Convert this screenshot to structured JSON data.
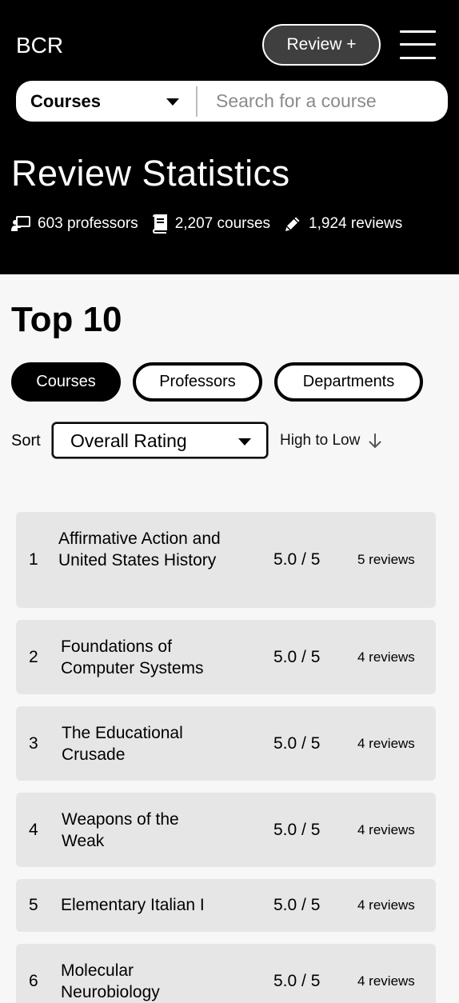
{
  "header": {
    "logo": "BCR",
    "review_button": "Review +",
    "menu_icon": "hamburger-icon"
  },
  "search": {
    "category": "Courses",
    "placeholder": "Search for a course"
  },
  "stats_section": {
    "title": "Review Statistics",
    "professors": "603 professors",
    "courses": "2,207 courses",
    "reviews": "1,924 reviews",
    "icons": [
      "teacher-icon",
      "book-icon",
      "pencil-icon"
    ]
  },
  "top10": {
    "title": "Top 10",
    "tabs": [
      {
        "label": "Courses",
        "active": true
      },
      {
        "label": "Professors",
        "active": false
      },
      {
        "label": "Departments",
        "active": false
      }
    ],
    "sort_label": "Sort",
    "sort_value": "Overall Rating",
    "order_label": "High to Low",
    "rows": [
      {
        "rank": "1",
        "name": "Affirmative Action and United States History",
        "rating": "5.0 / 5",
        "reviews": "5 reviews"
      },
      {
        "rank": "2",
        "name": "Foundations of Computer Systems",
        "rating": "5.0 / 5",
        "reviews": "4 reviews"
      },
      {
        "rank": "3",
        "name": "The Educational Crusade",
        "rating": "5.0 / 5",
        "reviews": "4 reviews"
      },
      {
        "rank": "4",
        "name": "Weapons of the Weak",
        "rating": "5.0 / 5",
        "reviews": "4 reviews"
      },
      {
        "rank": "5",
        "name": "Elementary Italian I",
        "rating": "5.0 / 5",
        "reviews": "4 reviews"
      },
      {
        "rank": "6",
        "name": "Molecular Neurobiology",
        "rating": "5.0 / 5",
        "reviews": "4 reviews"
      }
    ]
  },
  "colors": {
    "header_bg": "#000000",
    "page_bg": "#f7f7f7",
    "row_bg": "#e6e6e6",
    "review_button_bg": "#3f3f3f"
  }
}
